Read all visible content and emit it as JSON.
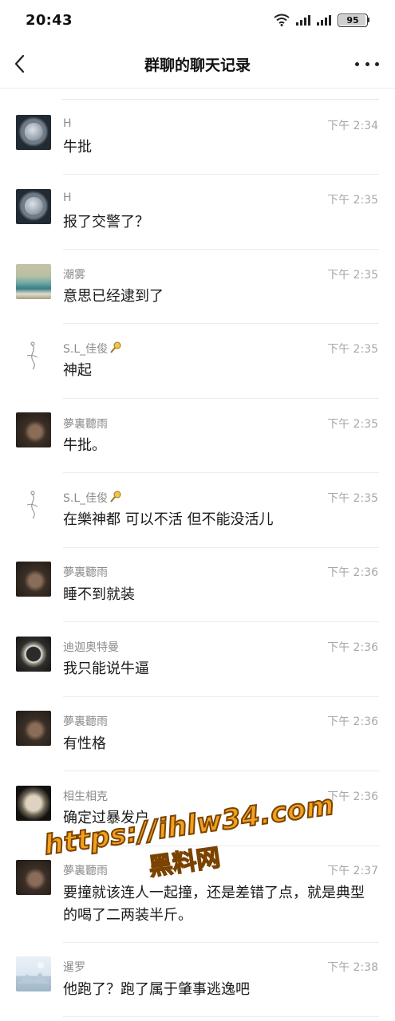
{
  "status_bar": {
    "time": "20:43",
    "battery": "95"
  },
  "nav": {
    "title": "群聊的聊天记录"
  },
  "messages": [
    {
      "sender": "H",
      "time": "下午 2:34",
      "text": "牛批"
    },
    {
      "sender": "H",
      "time": "下午 2:35",
      "text": "报了交警了？"
    },
    {
      "sender": "潮雾",
      "time": "下午 2:35",
      "text": "意思已经逮到了"
    },
    {
      "sender": "S.L_佳俊",
      "time": "下午 2:35",
      "text": "神起"
    },
    {
      "sender": "夢裏聽雨",
      "time": "下午 2:35",
      "text": "牛批。"
    },
    {
      "sender": "S.L_佳俊",
      "time": "下午 2:35",
      "text": "在樂神都 可以不活 但不能没活儿"
    },
    {
      "sender": "夢裏聽雨",
      "time": "下午 2:36",
      "text": "睡不到就装"
    },
    {
      "sender": "迪迦奥特曼",
      "time": "下午 2:36",
      "text": "我只能说牛逼"
    },
    {
      "sender": "夢裏聽雨",
      "time": "下午 2:36",
      "text": "有性格"
    },
    {
      "sender": "相生相克",
      "time": "下午 2:36",
      "text": "确定过暴发户"
    },
    {
      "sender": "夢裏聽雨",
      "time": "下午 2:37",
      "text": "要撞就该连人一起撞，还是差错了点，就是典型的喝了二两装半斤。"
    },
    {
      "sender": "暹罗",
      "time": "下午 2:38",
      "text": "他跑了？跑了属于肇事逃逸吧"
    }
  ],
  "watermark": {
    "line1": "https://ihlw34.com",
    "line2": "黑料网"
  },
  "icons": {
    "back": "chevron-left-icon",
    "more": "more-dots-icon",
    "wifi": "wifi-icon",
    "signal": "cellular-signal-icon",
    "battery": "battery-icon"
  }
}
